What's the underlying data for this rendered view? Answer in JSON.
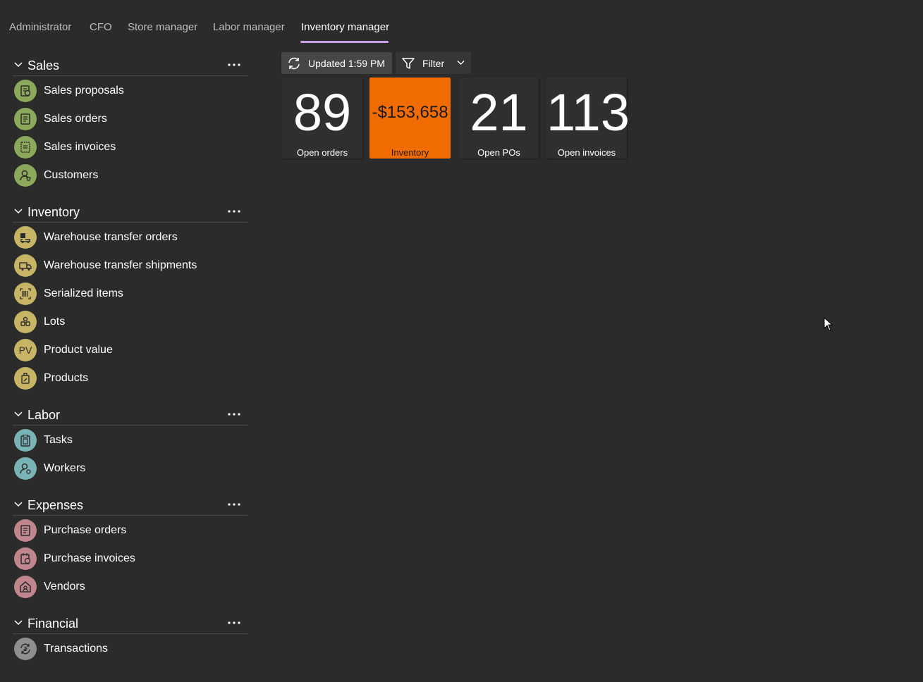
{
  "tabs": [
    {
      "label": "Administrator"
    },
    {
      "label": "CFO"
    },
    {
      "label": "Store manager"
    },
    {
      "label": "Labor manager"
    },
    {
      "label": "Inventory manager",
      "active": true
    }
  ],
  "sidebar": {
    "groups": [
      {
        "title": "Sales",
        "items": [
          {
            "label": "Sales proposals",
            "icon": "sales-proposal-icon"
          },
          {
            "label": "Sales orders",
            "icon": "document-icon"
          },
          {
            "label": "Sales invoices",
            "icon": "invoice-icon"
          },
          {
            "label": "Customers",
            "icon": "customer-icon"
          }
        ]
      },
      {
        "title": "Inventory",
        "items": [
          {
            "label": "Warehouse transfer orders",
            "icon": "forklift-icon"
          },
          {
            "label": "Warehouse transfer shipments",
            "icon": "truck-icon"
          },
          {
            "label": "Serialized items",
            "icon": "barcode-icon"
          },
          {
            "label": "Lots",
            "icon": "lots-icon"
          },
          {
            "label": "Product value",
            "icon": "pv-icon",
            "initials": "PV"
          },
          {
            "label": "Products",
            "icon": "product-icon"
          }
        ]
      },
      {
        "title": "Labor",
        "items": [
          {
            "label": "Tasks",
            "icon": "clipboard-icon"
          },
          {
            "label": "Workers",
            "icon": "worker-icon"
          }
        ]
      },
      {
        "title": "Expenses",
        "items": [
          {
            "label": "Purchase orders",
            "icon": "purchase-order-icon"
          },
          {
            "label": "Purchase invoices",
            "icon": "purchase-invoice-icon"
          },
          {
            "label": "Vendors",
            "icon": "vendor-icon"
          }
        ]
      },
      {
        "title": "Financial",
        "items": [
          {
            "label": "Transactions",
            "icon": "transactions-icon"
          }
        ]
      }
    ]
  },
  "toolbar": {
    "updated_label": "Updated 1:59 PM",
    "filter_label": "Filter"
  },
  "tiles": [
    {
      "value": "89",
      "caption": "Open orders"
    },
    {
      "value": "-$153,658",
      "caption": "Inventory",
      "color": "#f06c00"
    },
    {
      "value": "21",
      "caption": "Open POs"
    },
    {
      "value": "113",
      "caption": "Open invoices"
    }
  ],
  "colors": {
    "background": "#2b2b2b",
    "accent_underline": "#c79ee6",
    "sales_icon": "#8ca85a",
    "inventory_icon": "#c7b464",
    "labor_icon": "#7ab3b6",
    "expenses_icon": "#c0868e",
    "financial_icon": "#8f8f8f",
    "inventory_tile": "#f06c00"
  }
}
